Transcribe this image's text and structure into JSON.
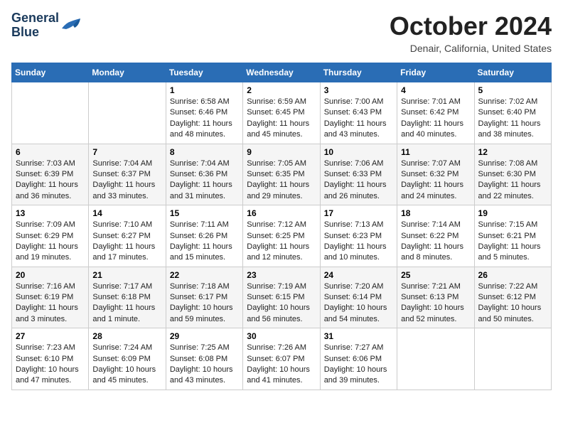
{
  "header": {
    "logo_line1": "General",
    "logo_line2": "Blue",
    "month_title": "October 2024",
    "location": "Denair, California, United States"
  },
  "weekdays": [
    "Sunday",
    "Monday",
    "Tuesday",
    "Wednesday",
    "Thursday",
    "Friday",
    "Saturday"
  ],
  "weeks": [
    [
      {
        "day": "",
        "info": ""
      },
      {
        "day": "",
        "info": ""
      },
      {
        "day": "1",
        "info": "Sunrise: 6:58 AM\nSunset: 6:46 PM\nDaylight: 11 hours and 48 minutes."
      },
      {
        "day": "2",
        "info": "Sunrise: 6:59 AM\nSunset: 6:45 PM\nDaylight: 11 hours and 45 minutes."
      },
      {
        "day": "3",
        "info": "Sunrise: 7:00 AM\nSunset: 6:43 PM\nDaylight: 11 hours and 43 minutes."
      },
      {
        "day": "4",
        "info": "Sunrise: 7:01 AM\nSunset: 6:42 PM\nDaylight: 11 hours and 40 minutes."
      },
      {
        "day": "5",
        "info": "Sunrise: 7:02 AM\nSunset: 6:40 PM\nDaylight: 11 hours and 38 minutes."
      }
    ],
    [
      {
        "day": "6",
        "info": "Sunrise: 7:03 AM\nSunset: 6:39 PM\nDaylight: 11 hours and 36 minutes."
      },
      {
        "day": "7",
        "info": "Sunrise: 7:04 AM\nSunset: 6:37 PM\nDaylight: 11 hours and 33 minutes."
      },
      {
        "day": "8",
        "info": "Sunrise: 7:04 AM\nSunset: 6:36 PM\nDaylight: 11 hours and 31 minutes."
      },
      {
        "day": "9",
        "info": "Sunrise: 7:05 AM\nSunset: 6:35 PM\nDaylight: 11 hours and 29 minutes."
      },
      {
        "day": "10",
        "info": "Sunrise: 7:06 AM\nSunset: 6:33 PM\nDaylight: 11 hours and 26 minutes."
      },
      {
        "day": "11",
        "info": "Sunrise: 7:07 AM\nSunset: 6:32 PM\nDaylight: 11 hours and 24 minutes."
      },
      {
        "day": "12",
        "info": "Sunrise: 7:08 AM\nSunset: 6:30 PM\nDaylight: 11 hours and 22 minutes."
      }
    ],
    [
      {
        "day": "13",
        "info": "Sunrise: 7:09 AM\nSunset: 6:29 PM\nDaylight: 11 hours and 19 minutes."
      },
      {
        "day": "14",
        "info": "Sunrise: 7:10 AM\nSunset: 6:27 PM\nDaylight: 11 hours and 17 minutes."
      },
      {
        "day": "15",
        "info": "Sunrise: 7:11 AM\nSunset: 6:26 PM\nDaylight: 11 hours and 15 minutes."
      },
      {
        "day": "16",
        "info": "Sunrise: 7:12 AM\nSunset: 6:25 PM\nDaylight: 11 hours and 12 minutes."
      },
      {
        "day": "17",
        "info": "Sunrise: 7:13 AM\nSunset: 6:23 PM\nDaylight: 11 hours and 10 minutes."
      },
      {
        "day": "18",
        "info": "Sunrise: 7:14 AM\nSunset: 6:22 PM\nDaylight: 11 hours and 8 minutes."
      },
      {
        "day": "19",
        "info": "Sunrise: 7:15 AM\nSunset: 6:21 PM\nDaylight: 11 hours and 5 minutes."
      }
    ],
    [
      {
        "day": "20",
        "info": "Sunrise: 7:16 AM\nSunset: 6:19 PM\nDaylight: 11 hours and 3 minutes."
      },
      {
        "day": "21",
        "info": "Sunrise: 7:17 AM\nSunset: 6:18 PM\nDaylight: 11 hours and 1 minute."
      },
      {
        "day": "22",
        "info": "Sunrise: 7:18 AM\nSunset: 6:17 PM\nDaylight: 10 hours and 59 minutes."
      },
      {
        "day": "23",
        "info": "Sunrise: 7:19 AM\nSunset: 6:15 PM\nDaylight: 10 hours and 56 minutes."
      },
      {
        "day": "24",
        "info": "Sunrise: 7:20 AM\nSunset: 6:14 PM\nDaylight: 10 hours and 54 minutes."
      },
      {
        "day": "25",
        "info": "Sunrise: 7:21 AM\nSunset: 6:13 PM\nDaylight: 10 hours and 52 minutes."
      },
      {
        "day": "26",
        "info": "Sunrise: 7:22 AM\nSunset: 6:12 PM\nDaylight: 10 hours and 50 minutes."
      }
    ],
    [
      {
        "day": "27",
        "info": "Sunrise: 7:23 AM\nSunset: 6:10 PM\nDaylight: 10 hours and 47 minutes."
      },
      {
        "day": "28",
        "info": "Sunrise: 7:24 AM\nSunset: 6:09 PM\nDaylight: 10 hours and 45 minutes."
      },
      {
        "day": "29",
        "info": "Sunrise: 7:25 AM\nSunset: 6:08 PM\nDaylight: 10 hours and 43 minutes."
      },
      {
        "day": "30",
        "info": "Sunrise: 7:26 AM\nSunset: 6:07 PM\nDaylight: 10 hours and 41 minutes."
      },
      {
        "day": "31",
        "info": "Sunrise: 7:27 AM\nSunset: 6:06 PM\nDaylight: 10 hours and 39 minutes."
      },
      {
        "day": "",
        "info": ""
      },
      {
        "day": "",
        "info": ""
      }
    ]
  ]
}
